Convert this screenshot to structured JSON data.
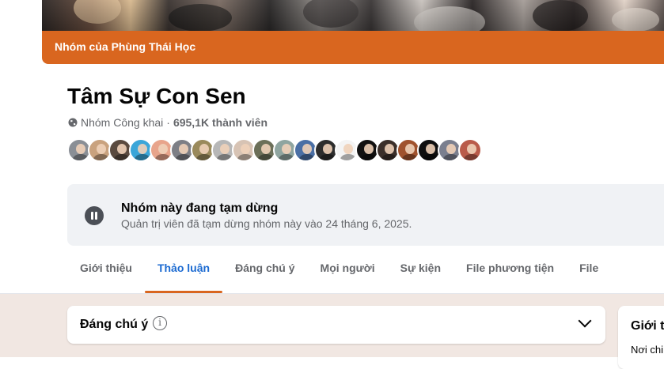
{
  "group": {
    "banner_text": "Nhóm của Phùng Thái Học",
    "title": "Tâm Sự Con Sen",
    "privacy": "Nhóm Công khai",
    "separator": "·",
    "members": "695,1K thành viên",
    "privacy_icon": "globe-icon"
  },
  "avatars": [
    {
      "bg": "#8a8f96"
    },
    {
      "bg": "#c9a27e"
    },
    {
      "bg": "#5a4a3f"
    },
    {
      "bg": "#3aa6d9"
    },
    {
      "bg": "#e8a48b"
    },
    {
      "bg": "#7d7f86"
    },
    {
      "bg": "#9a8a5c"
    },
    {
      "bg": "#b7b7b7"
    },
    {
      "bg": "#d7c3b4"
    },
    {
      "bg": "#6b6f58"
    },
    {
      "bg": "#8fa5a0"
    },
    {
      "bg": "#4a6fa5"
    },
    {
      "bg": "#2d2d2d"
    },
    {
      "bg": "#f4f4f4"
    },
    {
      "bg": "#111111"
    },
    {
      "bg": "#3b2f2a"
    },
    {
      "bg": "#a0522d"
    },
    {
      "bg": "#0f0f0f"
    },
    {
      "bg": "#7a7f8f"
    },
    {
      "bg": "#b95b4a"
    }
  ],
  "paused": {
    "title": "Nhóm này đang tạm dừng",
    "subtitle": "Quản trị viên đã tạm dừng nhóm này vào 24 tháng 6, 2025.",
    "icon": "pause-icon"
  },
  "tabs": [
    {
      "label": "Giới thiệu",
      "active": false
    },
    {
      "label": "Thảo luận",
      "active": true
    },
    {
      "label": "Đáng chú ý",
      "active": false
    },
    {
      "label": "Mọi người",
      "active": false
    },
    {
      "label": "Sự kiện",
      "active": false
    },
    {
      "label": "File phương tiện",
      "active": false
    },
    {
      "label": "File",
      "active": false
    }
  ],
  "featured": {
    "title": "Đáng chú ý",
    "info_icon_glyph": "i"
  },
  "side": {
    "title": "Giới th",
    "subtitle": "Nơi chi"
  },
  "colors": {
    "accent": "#d9661f",
    "active_tab": "#1b6ad1",
    "lower_bg": "#f1e7e2"
  }
}
